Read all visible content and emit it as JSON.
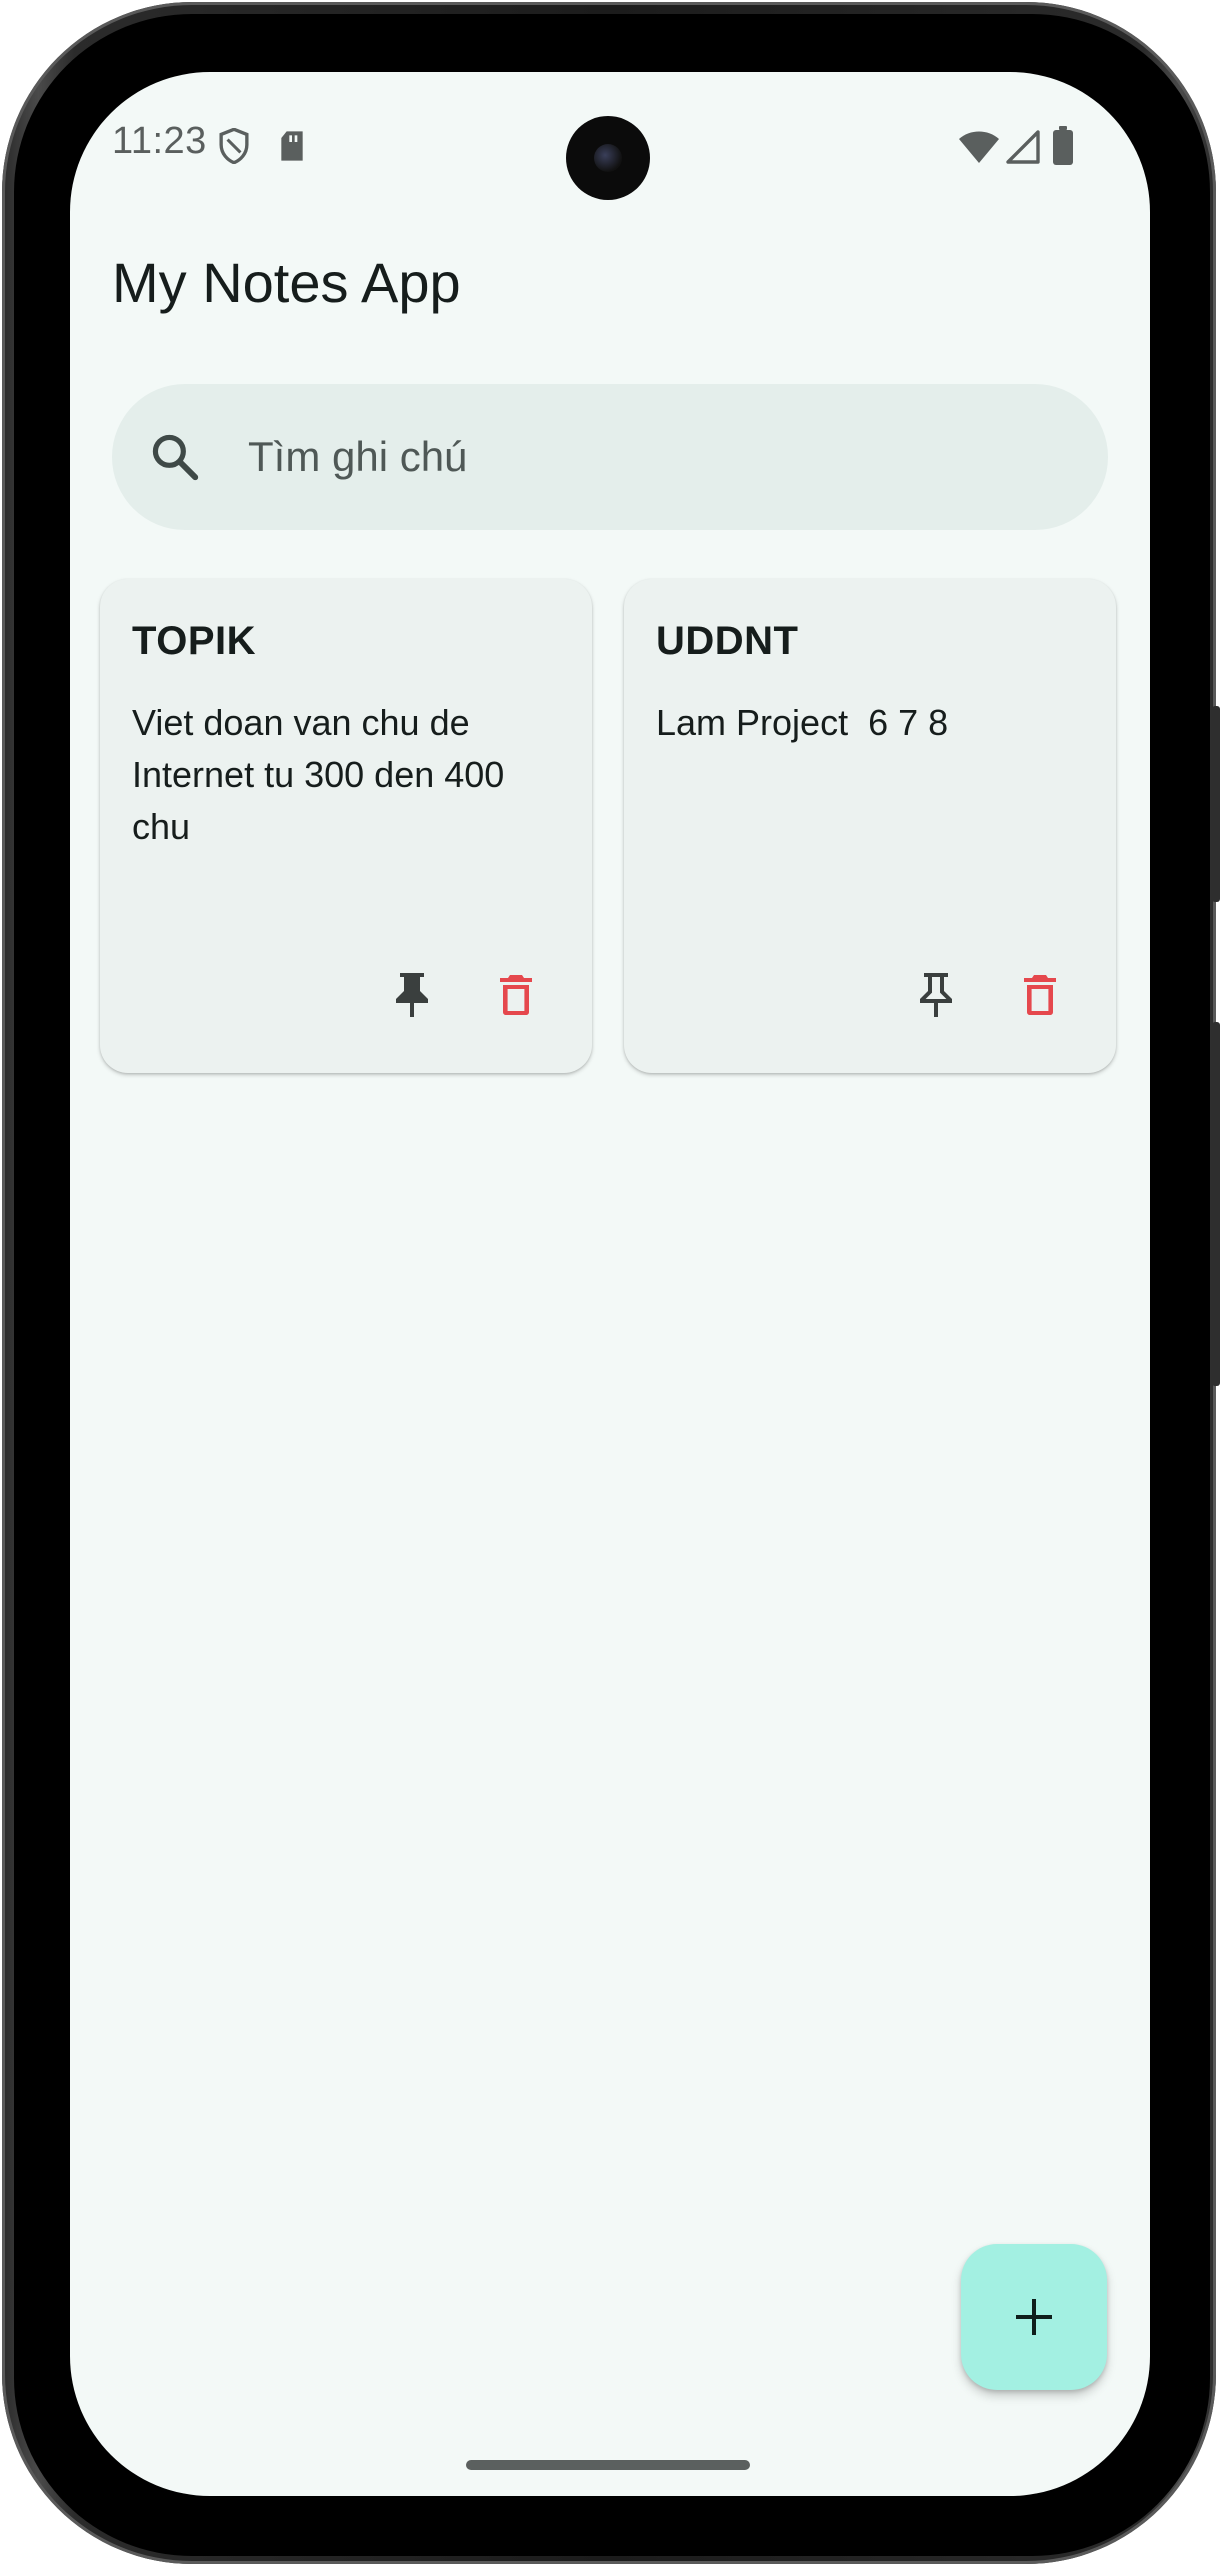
{
  "status_bar": {
    "time": "11:23",
    "left_icons": [
      "shield-icon",
      "sd-card-icon"
    ],
    "right_icons": [
      "wifi-icon",
      "cell-signal-icon",
      "battery-icon"
    ]
  },
  "app": {
    "title": "My Notes App"
  },
  "search": {
    "placeholder": "Tìm ghi chú",
    "value": "",
    "icon": "search-icon"
  },
  "notes": [
    {
      "title": "TOPIK",
      "body": "Viet doan van chu de Internet tu 300 den 400 chu",
      "pinned": true,
      "actions": [
        "pin-icon",
        "delete-icon"
      ]
    },
    {
      "title": "UDDNT",
      "body": "Lam Project  6 7 8",
      "pinned": false,
      "actions": [
        "pin-outline-icon",
        "delete-icon"
      ]
    }
  ],
  "fab": {
    "icon": "plus-icon",
    "color": "#a3f0e2"
  },
  "colors": {
    "background": "#f3f9f7",
    "card": "#ecf2f0",
    "search_bar": "#e4eeeb",
    "delete": "#e5484d",
    "text": "#161d1c"
  }
}
